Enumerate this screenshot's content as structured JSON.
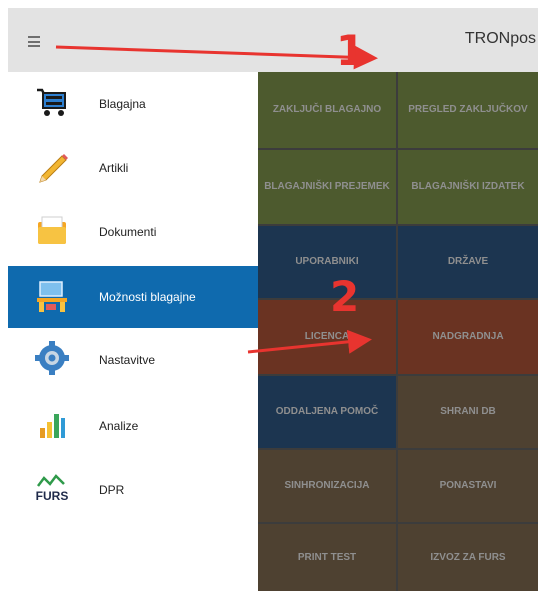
{
  "app_title": "TRONpos",
  "drawer": {
    "items": [
      {
        "label": "Blagajna",
        "icon": "cart-icon"
      },
      {
        "label": "Artikli",
        "icon": "pencil-icon"
      },
      {
        "label": "Dokumenti",
        "icon": "folder-icon"
      },
      {
        "label": "Možnosti blagajne",
        "icon": "cashier-desk-icon"
      },
      {
        "label": "Nastavitve",
        "icon": "gear-icon"
      },
      {
        "label": "Analize",
        "icon": "bar-chart-icon"
      },
      {
        "label": "DPR",
        "icon": "furs-logo-icon"
      }
    ],
    "active_index": 3
  },
  "tiles": [
    {
      "label": "ZAKLJUČI BLAGAJNO",
      "color": "#4d5a2e"
    },
    {
      "label": "PREGLED ZAKLJUČKOV",
      "color": "#4d5a2e"
    },
    {
      "label": "BLAGAJNIŠKI PREJEMEK",
      "color": "#4d5a2e"
    },
    {
      "label": "BLAGAJNIŠKI IZDATEK",
      "color": "#4d5a2e"
    },
    {
      "label": "UPORABNIKI",
      "color": "#1c3550"
    },
    {
      "label": "DRŽAVE",
      "color": "#1c3550"
    },
    {
      "label": "LICENCA",
      "color": "#6a3322"
    },
    {
      "label": "NADGRADNJA",
      "color": "#6a3322"
    },
    {
      "label": "ODDALJENA POMOČ",
      "color": "#1c3550"
    },
    {
      "label": "SHRANI DB",
      "color": "#4e4131"
    },
    {
      "label": "SINHRONIZACIJA",
      "color": "#4e4131"
    },
    {
      "label": "PONASTAVI",
      "color": "#4e4131"
    },
    {
      "label": "PRINT TEST",
      "color": "#4e4131"
    },
    {
      "label": "IZVOZ ZA FURS",
      "color": "#4e4131"
    }
  ],
  "furs_logo_text": "FURS",
  "annotations": [
    {
      "number": "1",
      "color": "#e8342f"
    },
    {
      "number": "2",
      "color": "#e8342f"
    }
  ]
}
